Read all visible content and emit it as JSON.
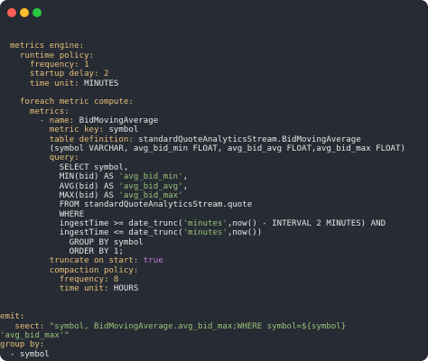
{
  "lines": [
    {
      "k": "",
      "v": "",
      "vt": "p"
    },
    {
      "k": "  metrics engine:",
      "v": "",
      "vt": "p"
    },
    {
      "k": "    runtime policy:",
      "v": "",
      "vt": "p"
    },
    {
      "k": "      frequency:",
      "v": " 1",
      "vt": "n"
    },
    {
      "k": "      startup delay:",
      "v": " 2",
      "vt": "n"
    },
    {
      "k": "      time unit:",
      "v": " MINUTES",
      "vt": "p"
    },
    {
      "k": "",
      "v": "",
      "vt": "p"
    },
    {
      "k": "    foreach metric compute:",
      "v": "",
      "vt": "p"
    },
    {
      "k": "      metrics:",
      "v": "",
      "vt": "p"
    },
    {
      "k": "        - name:",
      "v": " BidMovingAverage",
      "vt": "p"
    },
    {
      "k": "          metric key:",
      "v": " symbol",
      "vt": "p"
    },
    {
      "k": "          table definition:",
      "v": " standardQuoteAnalyticsStream.BidMovingAverage",
      "vt": "p"
    },
    {
      "k": "",
      "v": "          (symbol VARCHAR, avg_bid_min FLOAT, avg_bid_avg FLOAT,avg_bid_max FLOAT)",
      "vt": "p"
    },
    {
      "k": "          query:",
      "v": "",
      "vt": "p"
    },
    {
      "k": "",
      "v": "            SELECT symbol,",
      "vt": "p"
    },
    {
      "k": "",
      "v": "            MIN(bid) AS ",
      "vt": "p",
      "s": "'avg_bid_min'",
      "t": ","
    },
    {
      "k": "",
      "v": "            AVG(bid) AS ",
      "vt": "p",
      "s": "'avg_bid_avg'",
      "t": ","
    },
    {
      "k": "",
      "v": "            MAX(bid) AS ",
      "vt": "p",
      "s": "'avg_bid_max'",
      "t": ""
    },
    {
      "k": "",
      "v": "            FROM standardQuoteAnalyticsStream.quote",
      "vt": "p"
    },
    {
      "k": "",
      "v": "            WHERE",
      "vt": "p"
    },
    {
      "k": "",
      "v": "            ingestTime >= date_trunc(",
      "vt": "p",
      "s": "'minutes'",
      "t": ",now() - INTERVAL 2 MINUTES) AND"
    },
    {
      "k": "",
      "v": "            ingestTime <= date_trunc(",
      "vt": "p",
      "s": "'minutes'",
      "t": ",now())"
    },
    {
      "k": "",
      "v": "              GROUP BY symbol",
      "vt": "p"
    },
    {
      "k": "",
      "v": "              ORDER BY 1;",
      "vt": "p"
    },
    {
      "k": "          truncate on start:",
      "v": " true",
      "vt": "b"
    },
    {
      "k": "          compaction policy:",
      "v": "",
      "vt": "p"
    },
    {
      "k": "            frequency:",
      "v": " 8",
      "vt": "n"
    },
    {
      "k": "            time unit:",
      "v": " HOURS",
      "vt": "p"
    },
    {
      "k": "",
      "v": "",
      "vt": "p"
    },
    {
      "k": "",
      "v": "",
      "vt": "p"
    },
    {
      "k": "emit:",
      "v": "",
      "vt": "p"
    },
    {
      "k": "   seect:",
      "v": " \"symbol, BidMovingAverage.avg_bid_max;WHERE symbol=${symbol}",
      "vt": "s"
    },
    {
      "k": "",
      "v": "'avg_bid_max'\"",
      "vt": "s"
    },
    {
      "k": "group by:",
      "v": "",
      "vt": "p"
    },
    {
      "k": "",
      "v": "  - symbol",
      "vt": "p"
    }
  ]
}
